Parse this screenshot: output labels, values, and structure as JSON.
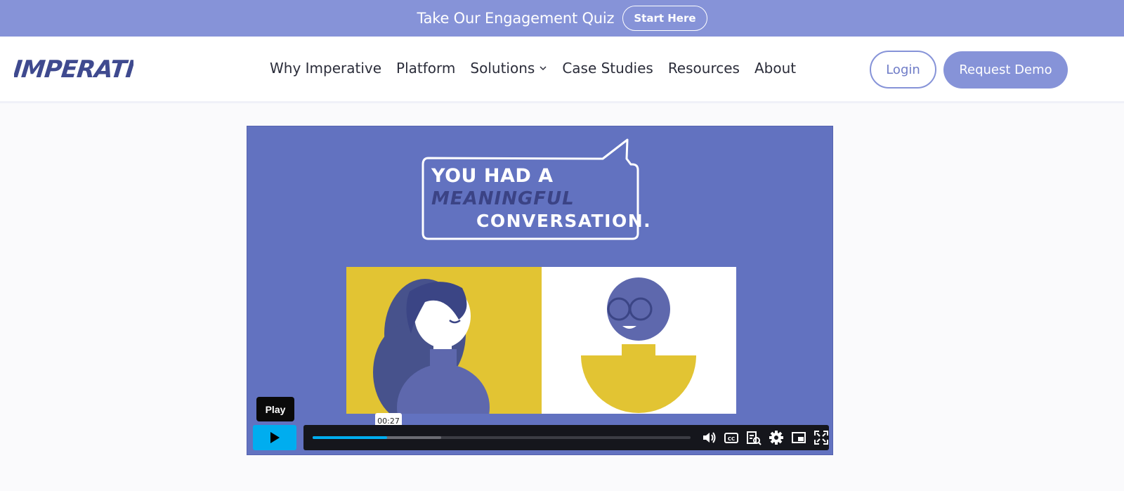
{
  "promo": {
    "text": "Take Our Engagement Quiz",
    "button": "Start Here"
  },
  "header": {
    "logo_text": "IMPERATIVE",
    "nav": [
      {
        "label": "Why Imperative"
      },
      {
        "label": "Platform"
      },
      {
        "label": "Solutions",
        "has_dropdown": true
      },
      {
        "label": "Case Studies"
      },
      {
        "label": "Resources"
      },
      {
        "label": "About"
      }
    ],
    "login": "Login",
    "demo": "Request Demo"
  },
  "video": {
    "caption_line1": "YOU HAD A",
    "caption_line2": "MEANINGFUL",
    "caption_line3": "CONVERSATION.",
    "tooltip": "Play",
    "time": "00:27",
    "progress_played_fraction": 0.197,
    "progress_buffered_fraction": 0.34,
    "controls": [
      "volume-icon",
      "captions-icon",
      "transcript-icon",
      "settings-icon",
      "pip-icon",
      "fullscreen-icon"
    ]
  },
  "colors": {
    "brand": "#8693d8",
    "video_bg": "#6272c0",
    "accent": "#00adef",
    "yellow": "#e2c433"
  }
}
